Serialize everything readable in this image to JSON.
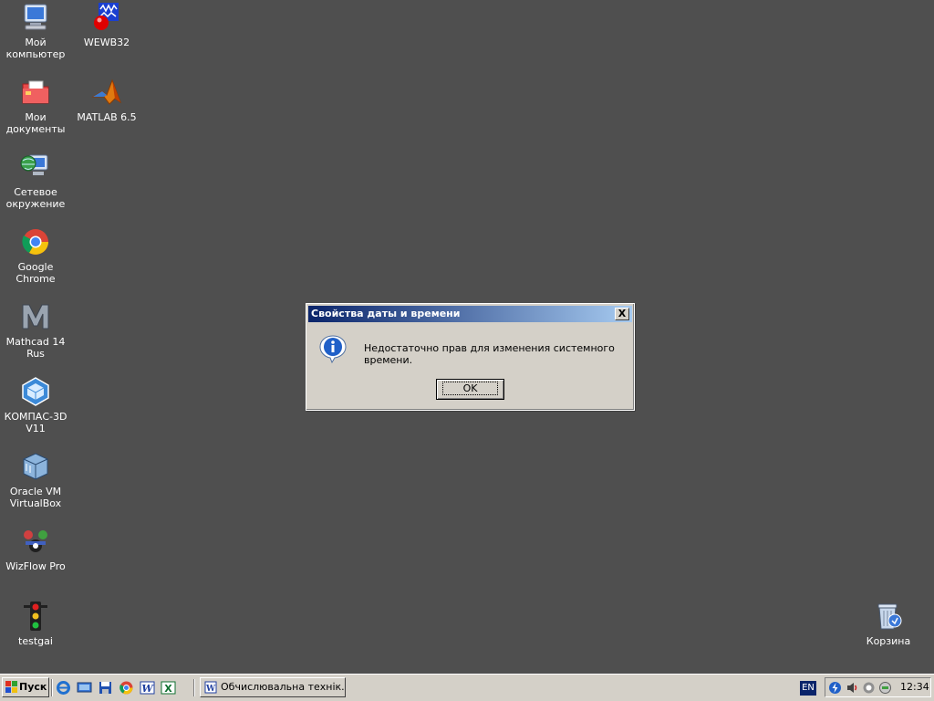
{
  "desktop": {
    "icons": [
      {
        "label": "Мой\nкомпьютер",
        "icon": "my-computer-icon"
      },
      {
        "label": "WEWB32",
        "icon": "wewb32-icon"
      },
      {
        "label": "Мои\nдокументы",
        "icon": "my-documents-icon"
      },
      {
        "label": "MATLAB 6.5",
        "icon": "matlab-icon"
      },
      {
        "label": "Сетевое\nокружение",
        "icon": "network-icon"
      },
      {
        "label": "Google Chrome",
        "icon": "chrome-icon"
      },
      {
        "label": "Mathcad 14\nRus",
        "icon": "mathcad-icon"
      },
      {
        "label": "КОМПАС-3D\nV11",
        "icon": "kompas-icon"
      },
      {
        "label": "Oracle VM\nVirtualBox",
        "icon": "virtualbox-icon"
      },
      {
        "label": "WizFlow Pro",
        "icon": "wizflow-icon"
      },
      {
        "label": "testgai",
        "icon": "traffic-light-icon"
      },
      {
        "label": "Корзина",
        "icon": "recycle-bin-icon"
      }
    ]
  },
  "dialog": {
    "title": "Свойства даты и времени",
    "close_label": "X",
    "message": "Недостаточно прав для изменения системного времени.",
    "ok_label": "OK"
  },
  "taskbar": {
    "start_label": "Пуск",
    "task_label": "Обчислювальна технік...",
    "language": "EN",
    "clock": "12:34"
  },
  "colors": {
    "desktop_bg": "#4f4f4f",
    "titlebar_start": "#0a246a",
    "titlebar_end": "#a6caf0",
    "face": "#d4d0c8"
  }
}
